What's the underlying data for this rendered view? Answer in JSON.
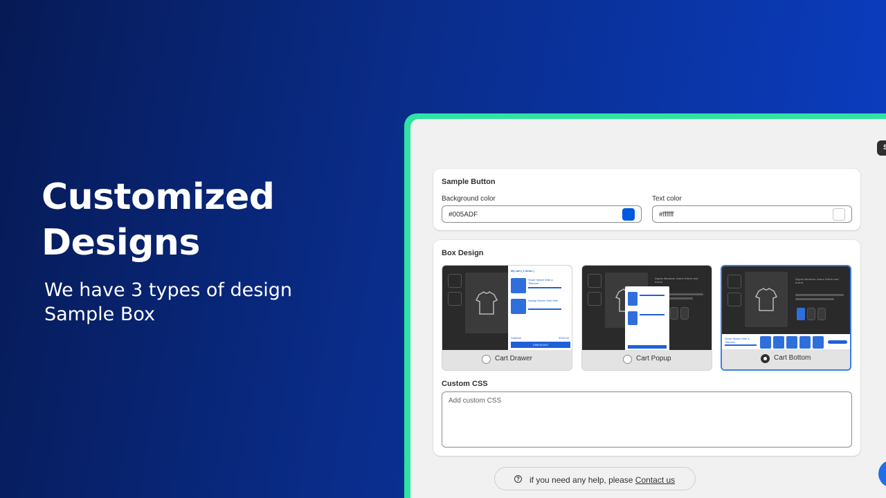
{
  "hero": {
    "title": "Customized\nDesigns",
    "subtitle": "We have 3 types of design\nSample Box"
  },
  "topbar": {
    "save_chip_label": "Save"
  },
  "sample_button": {
    "title": "Sample Button",
    "bg_label": "Background color",
    "bg_value": "#005ADF",
    "text_label": "Text color",
    "text_value": "#ffffff"
  },
  "box_design": {
    "title": "Box Design",
    "options": [
      {
        "label": "Cart Drawer",
        "selected": false,
        "preview": {
          "cart_header": "My cart ( 2 items )",
          "item1": "Smart Watch With a Titanium",
          "item2": "Varsity Dream Shirt Men",
          "subtotal_label": "Subtotal",
          "subtotal_value": "$750.00",
          "checkout": "CHECKOUT"
        }
      },
      {
        "label": "Cart Popup",
        "selected": false,
        "preview": {
          "product_title": "Dignis Bamboo Jeans Shirts and brand"
        }
      },
      {
        "label": "Cart Bottom",
        "selected": true,
        "preview": {
          "product_title": "Dignis Bamboo Jeans Shirts and brand",
          "bottom_item": "Smart Watch With a Titanium"
        }
      }
    ]
  },
  "custom_css": {
    "title": "Custom CSS",
    "placeholder": "Add custom CSS"
  },
  "help": {
    "text": "if you need any help, please",
    "link": "Contact us"
  },
  "colors": {
    "accent": "#005ADF",
    "frame": "#2fe3a0"
  }
}
